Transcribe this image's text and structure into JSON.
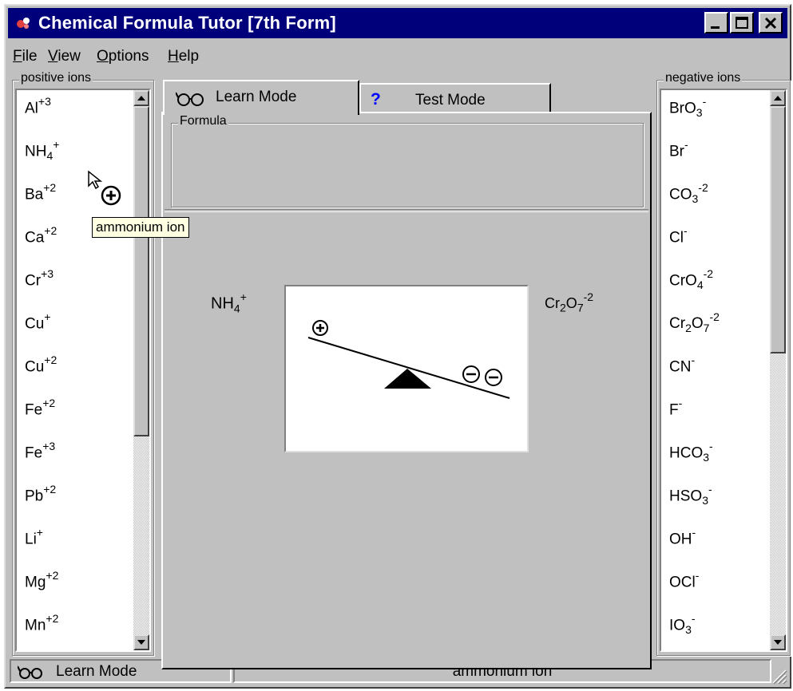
{
  "window": {
    "title": "Chemical Formula Tutor [7th Form]"
  },
  "menu": [
    {
      "hotkey": "F",
      "rest": "ile"
    },
    {
      "hotkey": "V",
      "rest": "iew"
    },
    {
      "hotkey": "O",
      "rest": "ptions"
    },
    {
      "hotkey": "H",
      "rest": "elp"
    }
  ],
  "positive": {
    "label": "positive ions",
    "items": [
      {
        "base": "Al",
        "sub": "",
        "sup": "+3"
      },
      {
        "base": "NH",
        "sub": "4",
        "sup": "+"
      },
      {
        "base": "Ba",
        "sub": "",
        "sup": "+2"
      },
      {
        "base": "Ca",
        "sub": "",
        "sup": "+2"
      },
      {
        "base": "Cr",
        "sub": "",
        "sup": "+3"
      },
      {
        "base": "Cu",
        "sub": "",
        "sup": "+"
      },
      {
        "base": "Cu",
        "sub": "",
        "sup": "+2"
      },
      {
        "base": "Fe",
        "sub": "",
        "sup": "+2"
      },
      {
        "base": "Fe",
        "sub": "",
        "sup": "+3"
      },
      {
        "base": "Pb",
        "sub": "",
        "sup": "+2"
      },
      {
        "base": "Li",
        "sub": "",
        "sup": "+"
      },
      {
        "base": "Mg",
        "sub": "",
        "sup": "+2"
      },
      {
        "base": "Mn",
        "sub": "",
        "sup": "+2"
      }
    ]
  },
  "negative": {
    "label": "negative ions",
    "items": [
      {
        "base": "BrO",
        "sub": "3",
        "sup": "-"
      },
      {
        "base": "Br",
        "sub": "",
        "sup": "-"
      },
      {
        "base": "CO",
        "sub": "3",
        "sup": "-2"
      },
      {
        "base": "Cl",
        "sub": "",
        "sup": "-"
      },
      {
        "base": "CrO",
        "sub": "4",
        "sup": "-2"
      },
      {
        "base": "Cr2O7",
        "sub": "",
        "sup": "-2"
      },
      {
        "base": "CN",
        "sub": "",
        "sup": "-"
      },
      {
        "base": "F",
        "sub": "",
        "sup": "-"
      },
      {
        "base": "HCO",
        "sub": "3",
        "sup": "-"
      },
      {
        "base": "HSO",
        "sub": "3",
        "sup": "-"
      },
      {
        "base": "OH",
        "sub": "",
        "sup": "-"
      },
      {
        "base": "OCl",
        "sub": "",
        "sup": "-"
      },
      {
        "base": "IO",
        "sub": "3",
        "sup": "-"
      }
    ]
  },
  "tabs": {
    "learn": "Learn Mode",
    "test": "Test Mode",
    "test_glyph": "?"
  },
  "formula": {
    "label": "Formula",
    "value": ""
  },
  "balance": {
    "left_ion": {
      "base": "NH",
      "sub": "4",
      "sup": "+"
    },
    "right_ion": {
      "sup": "-2"
    }
  },
  "tooltip": "ammonium ion",
  "status": {
    "mode": "Learn Mode",
    "message": "ammonium ion"
  },
  "colors": {
    "title_bg": "#00007b",
    "face": "#c0c0c0",
    "tooltip_bg": "#ffffe1"
  }
}
